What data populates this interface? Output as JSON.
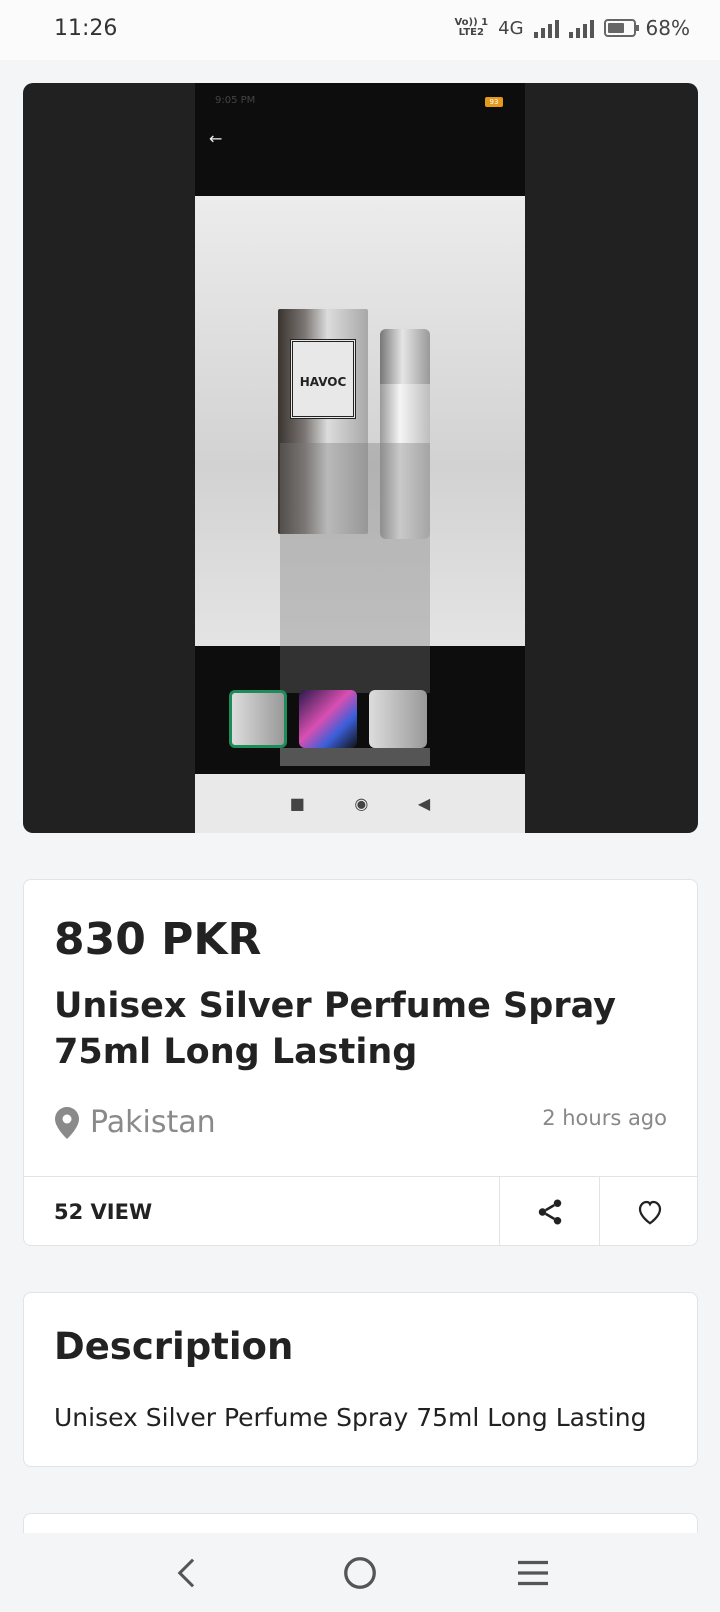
{
  "status_bar": {
    "time": "11:26",
    "volte": "Vo)) 1 LTE2",
    "network": "4G",
    "battery_percent": "68%",
    "battery_level": 0.68
  },
  "gallery": {
    "embedded_time": "9:05 PM",
    "embedded_battery": "93",
    "product_box_text": "HAVOC",
    "thumbnails": [
      {
        "selected": true
      },
      {
        "selected": false
      },
      {
        "selected": false
      }
    ]
  },
  "listing": {
    "price": "830 PKR",
    "title": "Unisex Silver Perfume Spray 75ml Long Lasting",
    "location": "Pakistan",
    "posted": "2 hours ago",
    "views": "52 VIEW"
  },
  "description": {
    "heading": "Description",
    "text": "Unisex Silver Perfume Spray 75ml Long Lasting"
  },
  "icons": {
    "location": "location-pin-icon",
    "share": "share-icon",
    "favorite": "heart-icon",
    "back": "back-icon",
    "home": "home-icon",
    "menu": "menu-icon"
  },
  "colors": {
    "thumbnail_selected": "#1e8c5a",
    "embedded_battery": "#e59a1b"
  }
}
